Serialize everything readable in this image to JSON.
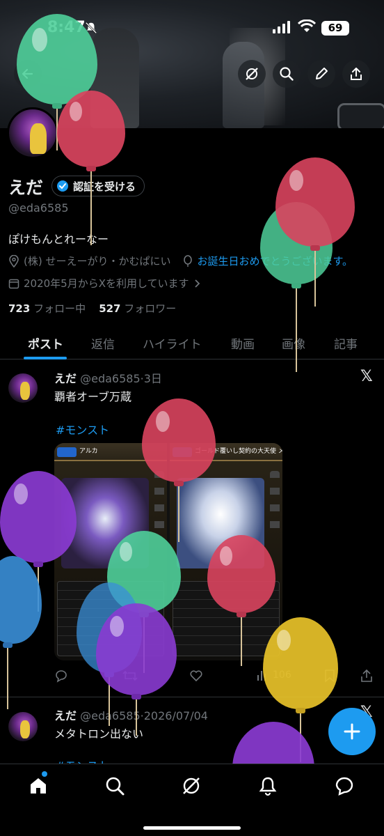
{
  "status_bar": {
    "time": "8:47",
    "battery": "69"
  },
  "profile": {
    "name": "えだ",
    "verify_label": "認証を受ける",
    "handle": "@eda6585",
    "bio": "ぽけもんとれーなー",
    "location": "(株) せーえーがり・かむぱにい",
    "birthday_link": "お誕生日おめでとうございます。",
    "joined": "2020年5月からXを利用しています",
    "following_count": "723",
    "following_label": "フォロー中",
    "followers_count": "527",
    "followers_label": "フォロワー"
  },
  "tabs": [
    "ポスト",
    "返信",
    "ハイライト",
    "動画",
    "画像",
    "記事"
  ],
  "posts": [
    {
      "name": "えだ",
      "handle": "@eda6585",
      "time": "3日",
      "text": "覇者オーブ万蔵",
      "hashtag": "#モンスト",
      "views": "106",
      "media": {
        "left": {
          "title": "アルカ"
        },
        "right": {
          "title": "ゴールド覆いし契約の大天使 メタトロン"
        }
      }
    },
    {
      "name": "えだ",
      "handle": "@eda6585",
      "time": "2026/07/04",
      "text": "メタトロン出ない",
      "hashtag": "#モンスト"
    }
  ],
  "colors": {
    "accent": "#1d9bf0",
    "background": "#000000",
    "muted": "#71767b",
    "balloon_green": "#4fcf9a",
    "balloon_red": "#d9445e",
    "balloon_purple": "#8a3bd1",
    "balloon_blue": "#3a8fd8",
    "balloon_yellow": "#e8c229"
  },
  "icons": {
    "back": "back-arrow-icon",
    "grok": "grok-icon",
    "search": "search-icon",
    "edit": "pencil-icon",
    "share": "share-icon",
    "location": "location-pin-icon",
    "birthday": "balloon-icon",
    "calendar": "calendar-icon",
    "x_logo": "x-logo-icon"
  }
}
